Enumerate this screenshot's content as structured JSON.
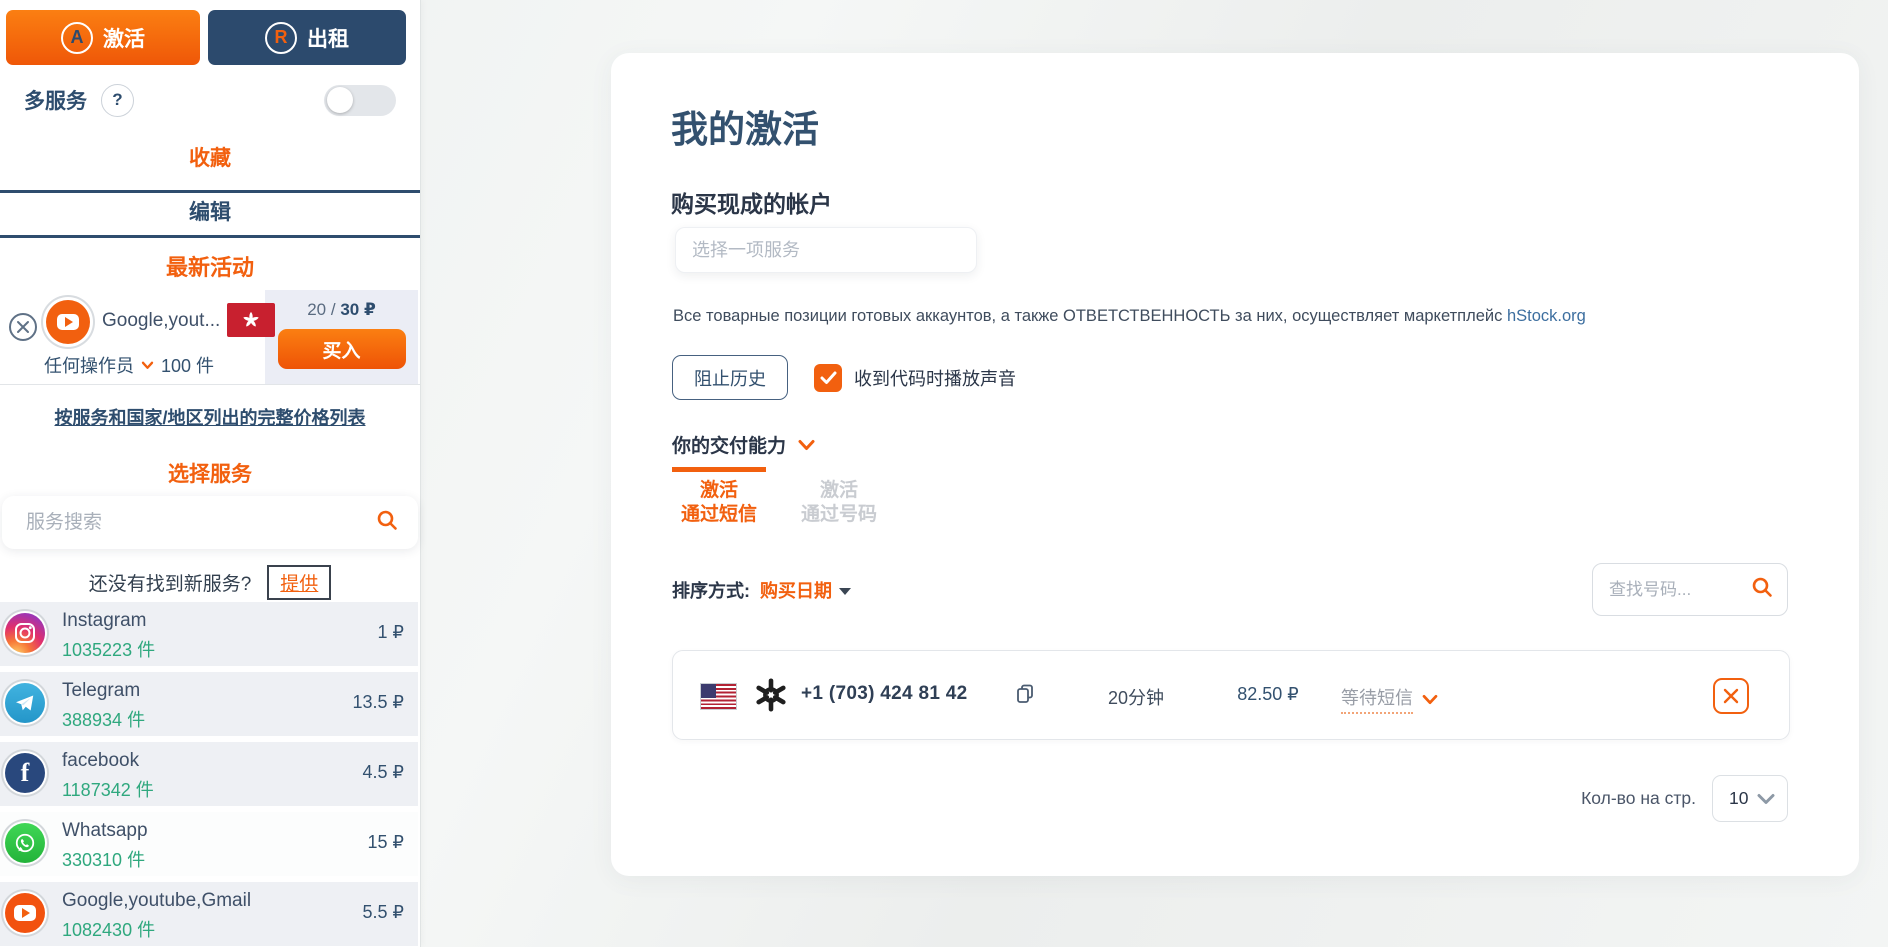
{
  "colors": {
    "accent": "#f2600f",
    "primary_dark": "#2e4d6e",
    "count_green": "#2fa87e"
  },
  "sidebar": {
    "activate_button": {
      "label": "激活",
      "icon_letter": "A"
    },
    "rent_button": {
      "label": "出租",
      "icon_letter": "R"
    },
    "multiservice_label": "多服务",
    "help_icon": "?",
    "favorites_tab": "收藏",
    "edit_tab": "编辑",
    "recent_activity_heading": "最新活动",
    "favorite": {
      "service_name": "Google,yout...",
      "country_flag": "hong-kong",
      "price_current": "20",
      "price_separator": "/",
      "price_total": "30 ₽",
      "buy_button": "买入",
      "operator_label": "任何操作员",
      "quantity": "100 件"
    },
    "full_price_list_link": "按服务和国家/地区列出的完整价格列表",
    "choose_service_heading": "选择服务",
    "service_search_placeholder": "服务搜索",
    "not_found_text": "还没有找到新服务?",
    "offer_link": "提供",
    "services": [
      {
        "name": "Instagram",
        "count": "1035223 件",
        "price": "1 ₽",
        "icon": "instagram"
      },
      {
        "name": "Telegram",
        "count": "388934 件",
        "price": "13.5 ₽",
        "icon": "telegram"
      },
      {
        "name": "facebook",
        "count": "1187342 件",
        "price": "4.5 ₽",
        "icon": "facebook"
      },
      {
        "name": "Whatsapp",
        "count": "330310 件",
        "price": "15 ₽",
        "icon": "whatsapp"
      },
      {
        "name": "Google,youtube,Gmail",
        "count": "1082430 件",
        "price": "5.5 ₽",
        "icon": "youtube"
      }
    ]
  },
  "main": {
    "title": "我的激活",
    "buy_accounts_heading": "购买现成的帐户",
    "service_select_placeholder": "选择一项服务",
    "marketplace_note": "Все товарные позиции готовых аккаунтов, а также ОТВЕТСТВЕННОСТЬ за них, осуществляет маркетплейс",
    "marketplace_link": "hStock.org",
    "block_history_button": "阻止历史",
    "sound_checkbox": {
      "label": "收到代码时播放声音",
      "checked": true
    },
    "delivery_heading": "你的交付能力",
    "tabs": [
      {
        "line1": "激活",
        "line2": "通过短信",
        "active": true
      },
      {
        "line1": "激活",
        "line2": "通过号码",
        "active": false
      }
    ],
    "sort_label": "排序方式:",
    "sort_value": "购买日期",
    "find_number_placeholder": "查找号码...",
    "activation_row": {
      "country": "united-states",
      "service_icon": "openai",
      "phone": "+1 (703) 424 81 42",
      "time_remaining": "20分钟",
      "price": "82.50 ₽",
      "status": "等待短信"
    },
    "per_page_label": "Кол-во на стр.",
    "per_page_value": "10"
  }
}
